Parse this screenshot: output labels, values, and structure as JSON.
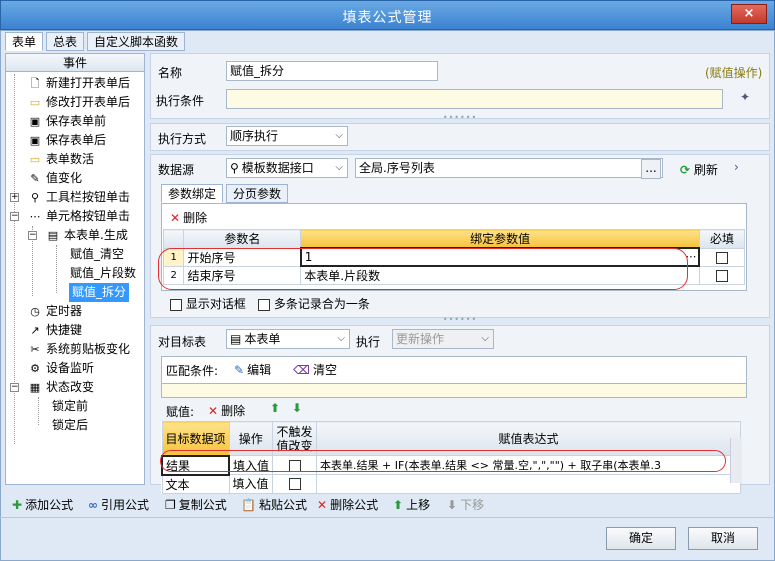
{
  "window": {
    "title": "填表公式管理",
    "close_glyph": "×"
  },
  "tabs": [
    "表单",
    "总表",
    "自定义脚本函数"
  ],
  "events": {
    "header": "事件",
    "items": [
      "新建打开表单后",
      "修改打开表单后",
      "保存表单前",
      "保存表单后",
      "表单数活",
      "值变化",
      "工具栏按钮单击",
      "单元格按钮单击",
      "本表单.生成",
      "赋值_清空",
      "赋值_片段数",
      "赋值_拆分",
      "定时器",
      "快捷键",
      "系统剪贴板变化",
      "设备监听",
      "状态改变",
      "锁定前",
      "锁定后"
    ]
  },
  "form": {
    "name_label": "名称",
    "name_value": "赋值_拆分",
    "op_hint": "(赋值操作)",
    "cond_label": "执行条件",
    "cond_value": "",
    "mode_label": "执行方式",
    "mode_value": "顺序执行"
  },
  "datasource": {
    "label": "数据源",
    "source": "模板数据接口",
    "path": "全局.序号列表",
    "browse": "...",
    "refresh": "刷新",
    "more": "›",
    "subtabs": [
      "参数绑定",
      "分页参数"
    ],
    "delete_label": "删除",
    "columns": [
      "参数名",
      "绑定参数值",
      "必填"
    ],
    "rows": [
      {
        "num": "1",
        "name": "开始序号",
        "value": "1"
      },
      {
        "num": "2",
        "name": "结束序号",
        "value": "本表单.片段数"
      }
    ],
    "opt_dialog": "显示对话框",
    "opt_merge": "多条记录合为一条"
  },
  "target": {
    "label": "对目标表",
    "table": "本表单",
    "exec_label": "执行",
    "exec_value": "更新操作",
    "match_label": "匹配条件:",
    "edit_label": "编辑",
    "clear_label": "清空",
    "assign_label": "赋值:",
    "delete_label": "删除",
    "columns": [
      "目标数据项",
      "操作",
      "不触发值改变",
      "赋值表达式"
    ],
    "rows": [
      {
        "item": "结果",
        "op": "填入值",
        "expr": "本表单.结果 + IF(本表单.结果 <> 常量.空,\",\",\"\") + 取子串(本表单.3"
      },
      {
        "item": "文本",
        "op": "填入值",
        "expr": ""
      }
    ]
  },
  "bottom": {
    "add": "添加公式",
    "ref": "引用公式",
    "copy": "复制公式",
    "paste": "粘贴公式",
    "del": "删除公式",
    "up": "上移",
    "down": "下移",
    "ok": "确定",
    "cancel": "取消"
  }
}
